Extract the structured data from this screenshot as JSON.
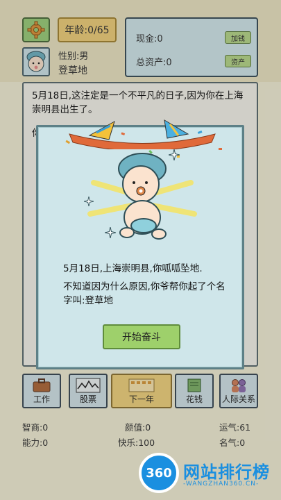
{
  "header": {
    "age_text": "年龄:0/65",
    "gender_text": "性别:男",
    "name_text": "登草地",
    "cash_label": "现金:0",
    "add_money_label": "加钱",
    "assets_label": "总资产:0",
    "assets_button_label": "资产"
  },
  "story": {
    "line1": "5月18日,这注定是一个不平凡的日子,因为你在上海崇明县出生了。",
    "line2": "你"
  },
  "actions": [
    {
      "label": "工作"
    },
    {
      "label": "股票"
    },
    {
      "label": "下一年"
    },
    {
      "label": "花钱"
    },
    {
      "label": "人际关系"
    }
  ],
  "stats": {
    "iq": "智商:0",
    "looks": "颜值:0",
    "luck": "运气:61",
    "ability": "能力:0",
    "happiness": "快乐:100",
    "fame": "名气:0"
  },
  "modal": {
    "line1": "5月18日,上海崇明县,你呱呱坠地.",
    "line2": "不知道因为什么原因,你爷帮你起了个名字叫:登草地",
    "start_button": "开始奋斗"
  },
  "watermark": {
    "logo": "360",
    "title": "网站排行榜",
    "subtitle": "-WANGZHAN360.CN-"
  },
  "colors": {
    "background": "#f3efd6",
    "modal_bg": "#cfe6ea",
    "button_green": "#9ed06b",
    "watermark_blue": "#1a8fe0"
  }
}
